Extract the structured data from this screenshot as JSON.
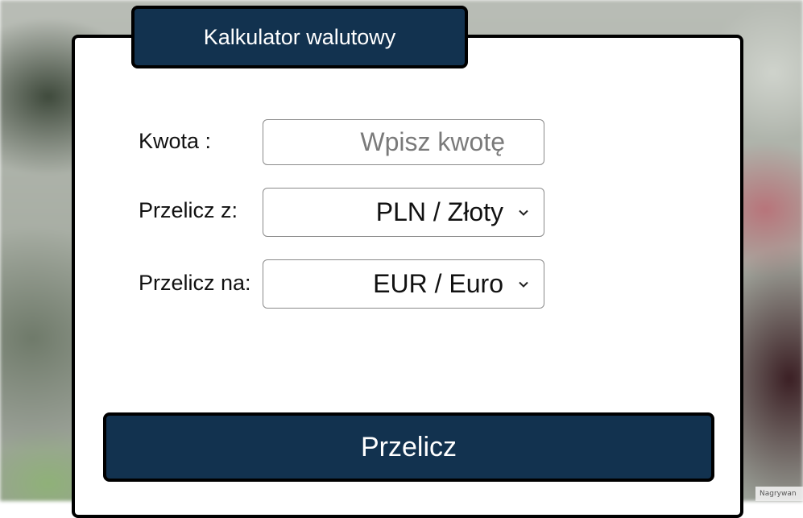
{
  "calculator": {
    "title": "Kalkulator walutowy",
    "amount": {
      "label": "Kwota :",
      "placeholder": "Wpisz kwotę",
      "value": ""
    },
    "from": {
      "label": "Przelicz z:",
      "selected": "PLN / Złoty"
    },
    "to": {
      "label": "Przelicz na:",
      "selected": "EUR / Euro"
    },
    "submit_label": "Przelicz"
  },
  "watermark": {
    "text": "Nagrywan"
  },
  "icons": {
    "dropdown": "chevron-down-icon"
  },
  "colors": {
    "primary": "#12324f",
    "border": "#000000",
    "card_bg": "#ffffff",
    "text": "#111111",
    "placeholder": "#7a7a7a"
  }
}
